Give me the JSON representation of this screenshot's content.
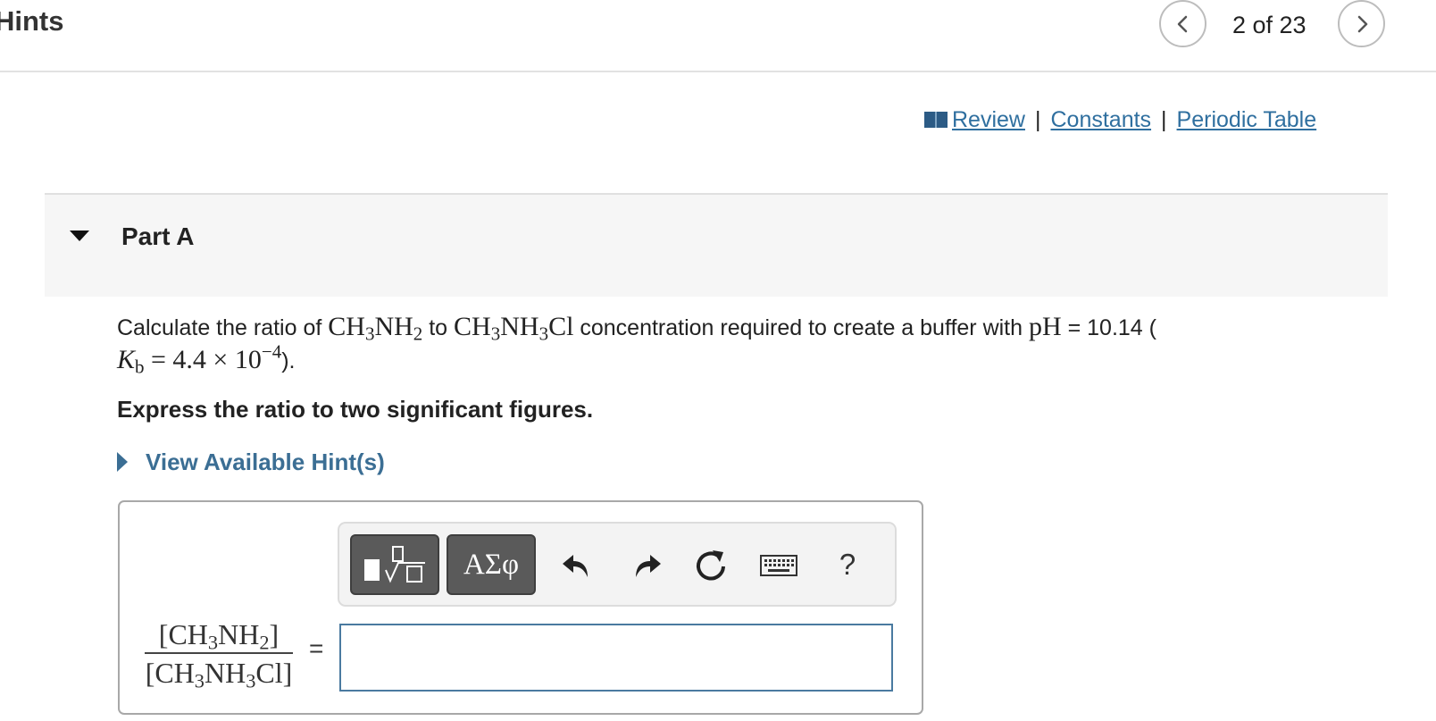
{
  "header": {
    "title": "Hints",
    "page_counter": "2 of 23",
    "prev_icon": "chevron-left-icon",
    "next_icon": "chevron-right-icon"
  },
  "links": {
    "review": "Review",
    "separator": "|",
    "constants": "Constants",
    "periodic_table": "Periodic Table",
    "review_icon": "book-icon",
    "link_color": "#2f6f9f"
  },
  "part": {
    "title": "Part A",
    "toggle_icon": "triangle-down-icon"
  },
  "question": {
    "text_1": "Calculate the ratio of ",
    "compound_1": {
      "a": "CH",
      "a_sub": "3",
      "b": "NH",
      "b_sub": "2"
    },
    "text_2": " to ",
    "compound_2": {
      "a": "CH",
      "a_sub": "3",
      "b": "NH",
      "b_sub": "3",
      "c": "Cl"
    },
    "text_3": " concentration required to create a buffer with ",
    "ph_label": "pH",
    "text_4": " = 10.14 (",
    "kb_label": "K",
    "kb_sub": "b",
    "kb_value": " = 4.4 × 10",
    "kb_exp": "−4",
    "text_5": ")."
  },
  "instruction": "Express the ratio to two significant figures.",
  "hint_toggle": {
    "label": "View Available Hint(s)",
    "color": "#3b6e94"
  },
  "toolbar": {
    "templates_icon": "math-templates-icon",
    "greek_label": "ΑΣφ",
    "undo_icon": "undo-icon",
    "redo_icon": "redo-icon",
    "reset_icon": "reset-icon",
    "keyboard_icon": "keyboard-icon",
    "help_label": "?"
  },
  "answer": {
    "numerator": {
      "a": "[CH",
      "a_sub": "3",
      "b": "NH",
      "b_sub": "2",
      "c": "]"
    },
    "denominator": {
      "a": "[CH",
      "a_sub": "3",
      "b": "NH",
      "b_sub": "3",
      "c": "Cl]"
    },
    "equals": "=",
    "input_value": "",
    "input_border_color": "#4a7aa0"
  }
}
